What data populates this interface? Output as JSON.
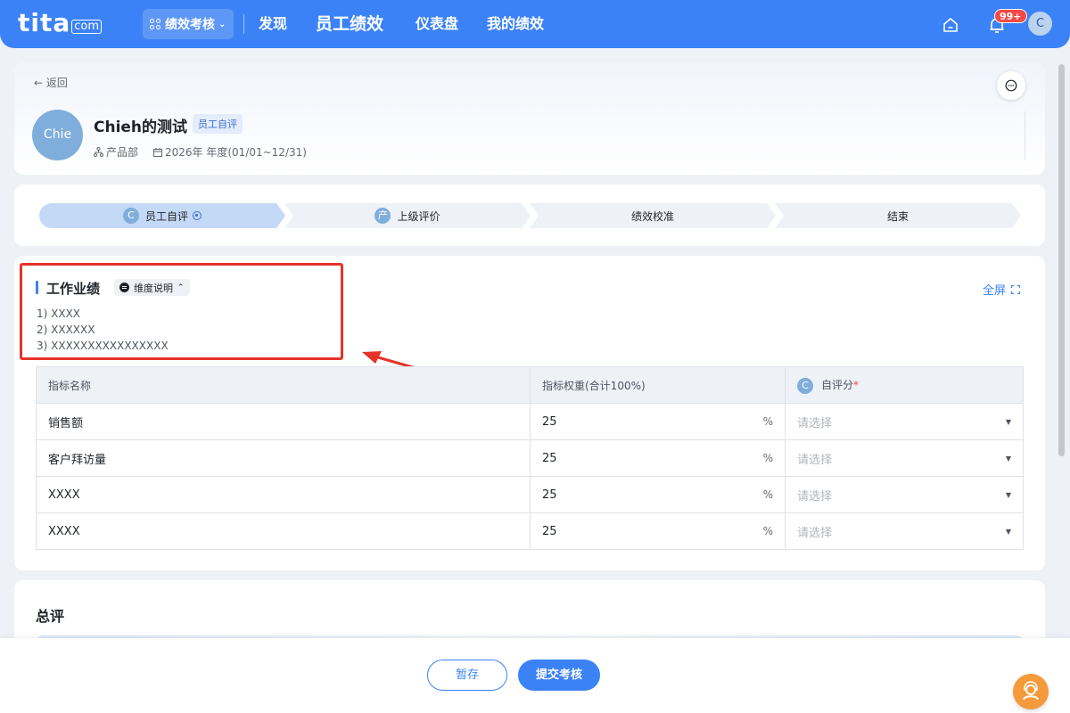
{
  "nav": {
    "logo": "tita",
    "logo_suffix": "com",
    "app_switch_label": "绩效考核",
    "items": [
      {
        "label": "发现"
      },
      {
        "label": "员工绩效"
      },
      {
        "label": "仪表盘"
      },
      {
        "label": "我的绩效"
      }
    ],
    "notification_badge": "99+",
    "user_avatar": "C"
  },
  "header": {
    "back_label": "返回",
    "avatar_text": "Chie",
    "name": "Chieh的测试",
    "stage_tag": "员工自评",
    "department": "产品部",
    "period": "2026年 年度(01/01~12/31)"
  },
  "steps": [
    {
      "icon": "C",
      "label": "员工自评"
    },
    {
      "icon": "产",
      "label": "上级评价"
    },
    {
      "label": "绩效校准"
    },
    {
      "label": "结束"
    }
  ],
  "work": {
    "title": "工作业绩",
    "dim_button": "维度说明",
    "fullscreen": "全屏",
    "descriptions": [
      "1) XXXX",
      "2) XXXXXX",
      "3) XXXXXXXXXXXXXXXX"
    ],
    "columns": {
      "name": "指标名称",
      "weight": "指标权重(合计100%)",
      "self_icon": "C",
      "self_score": "自评分",
      "required": "*"
    },
    "rows": [
      {
        "name": "销售额",
        "weight": "25",
        "unit": "%",
        "placeholder": "请选择"
      },
      {
        "name": "客户拜访量",
        "weight": "25",
        "unit": "%",
        "placeholder": "请选择"
      },
      {
        "name": "XXXX",
        "weight": "25",
        "unit": "%",
        "placeholder": "请选择"
      },
      {
        "name": "XXXX",
        "weight": "25",
        "unit": "%",
        "placeholder": "请选择"
      }
    ]
  },
  "summary": {
    "title": "总评"
  },
  "footer": {
    "save_label": "暂存",
    "submit_label": "提交考核"
  },
  "colors": {
    "primary": "#3b82f6",
    "highlight_box": "#e6332a",
    "badge": "#f54a45",
    "help": "#f59a3a"
  }
}
